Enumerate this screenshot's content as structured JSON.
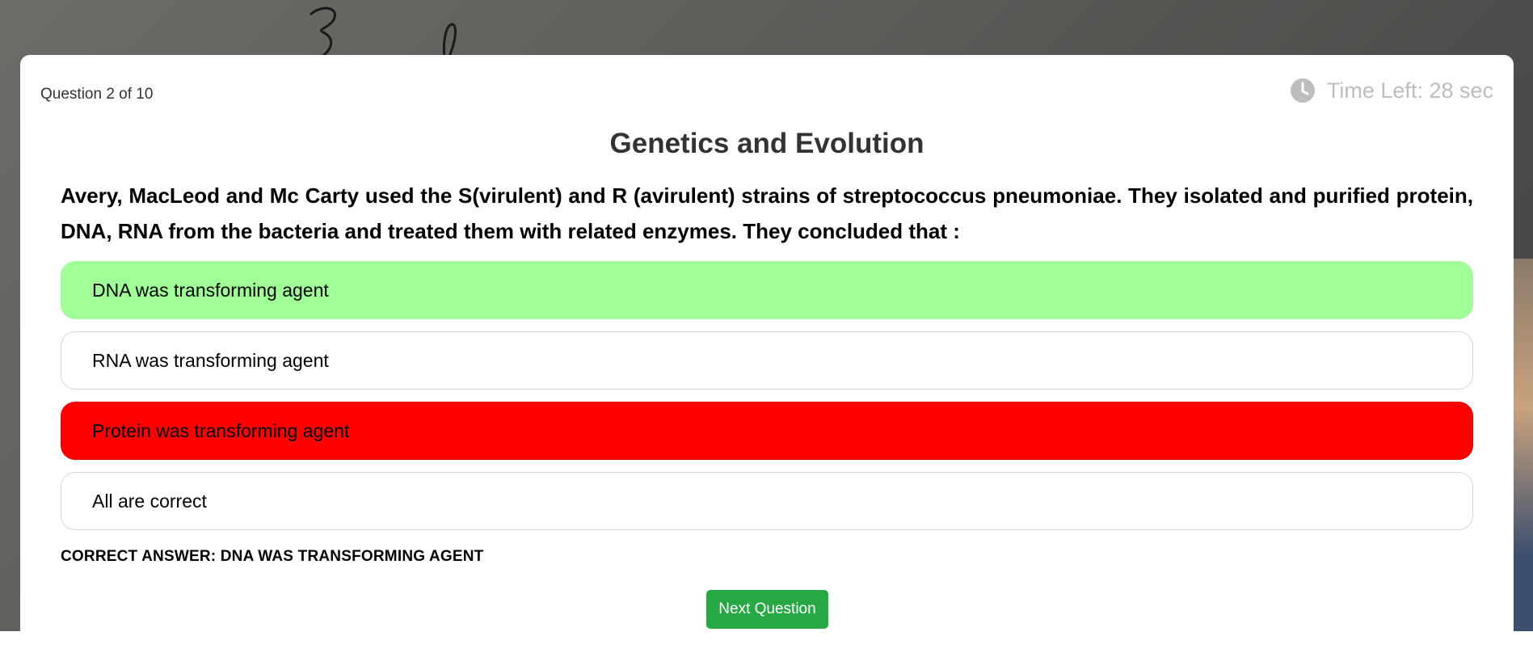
{
  "header": {
    "question_counter": "Question 2 of 10",
    "timer_text": "Time Left: 28 sec",
    "timer_icon": "clock-icon"
  },
  "quiz": {
    "title": "Genetics and Evolution",
    "question": "Avery, MacLeod and Mc Carty used the S(virulent) and R (avirulent) strains of streptococcus pneumoniae. They isolated and purified protein, DNA, RNA from the bacteria and treated them with related enzymes. They concluded that :",
    "options": [
      {
        "label": "DNA was transforming agent",
        "state": "correct"
      },
      {
        "label": "RNA was transforming agent",
        "state": "neutral"
      },
      {
        "label": "Protein was transforming agent",
        "state": "wrong"
      },
      {
        "label": "All are correct",
        "state": "neutral"
      }
    ],
    "correct_answer_text": "CORRECT ANSWER: DNA WAS TRANSFORMING AGENT",
    "next_label": "Next Question"
  },
  "colors": {
    "correct": "#a0ff96",
    "wrong": "#ff0000",
    "neutral": "#ffffff",
    "next_button": "#28a745"
  }
}
